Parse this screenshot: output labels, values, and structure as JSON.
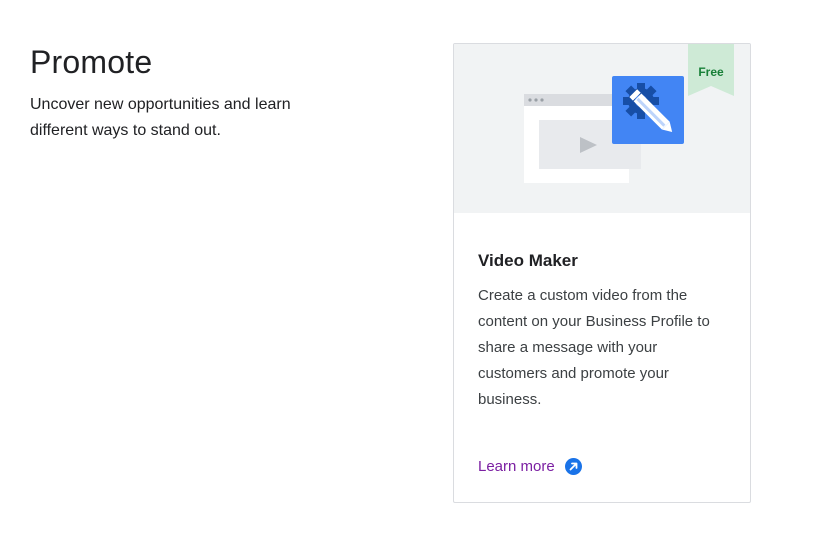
{
  "intro": {
    "title": "Promote",
    "description": "Uncover new opportunities and learn different ways to stand out."
  },
  "card": {
    "badge": "Free",
    "title": "Video Maker",
    "description": "Create a custom video from the content on your Business Profile to share a message with your customers and promote your business.",
    "link_label": "Learn more",
    "illustration_icon": "video-editor-icon",
    "link_icon": "external-link-arrow-icon",
    "colors": {
      "badge_bg": "#ceead6",
      "badge_text": "#188038",
      "accent_blue": "#4285f4",
      "link_purple": "#7b1fa2",
      "hero_bg": "#f1f3f4"
    }
  }
}
